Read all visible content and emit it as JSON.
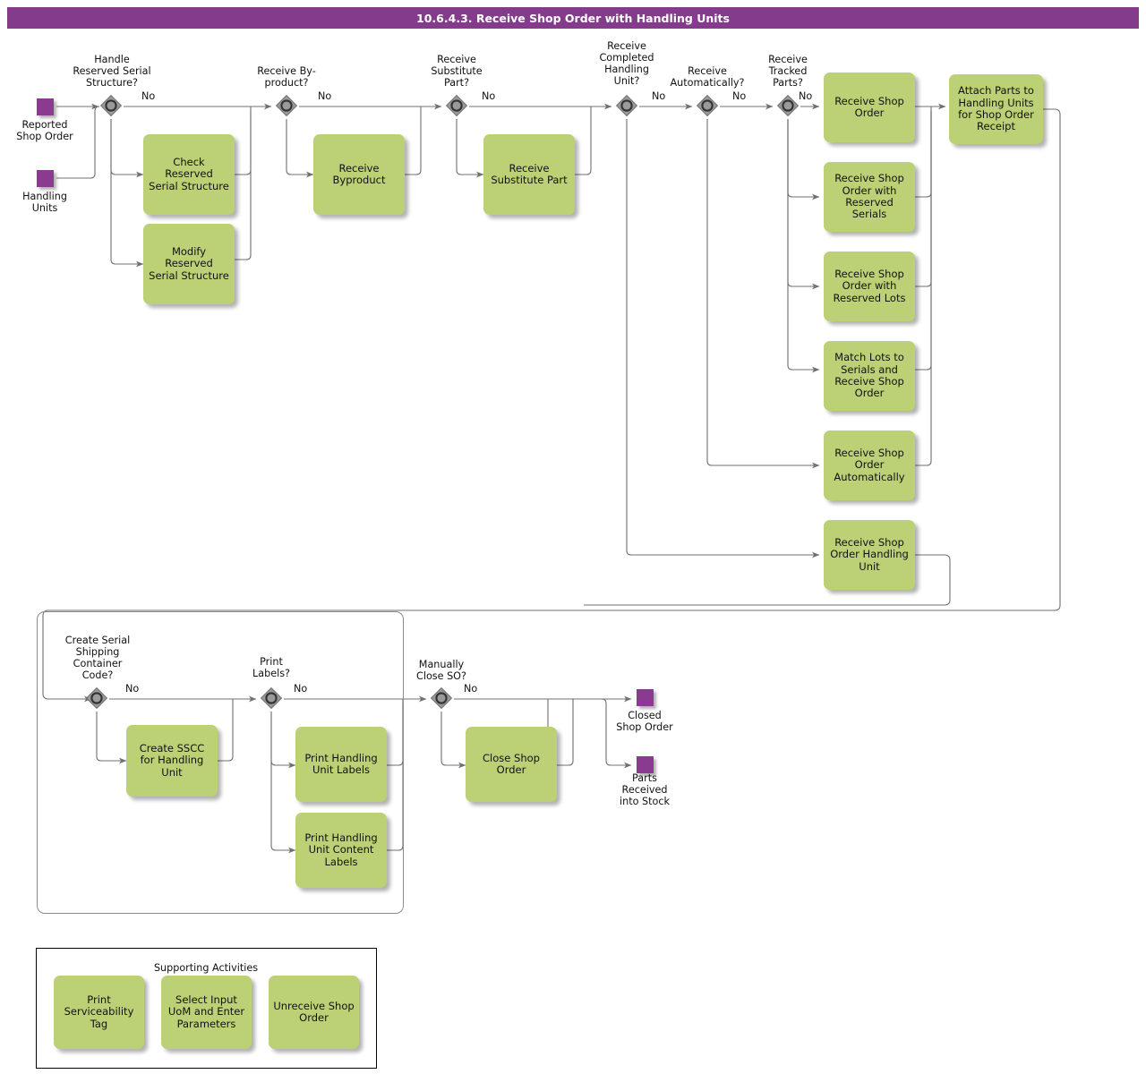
{
  "header": {
    "title": "10.6.4.3. Receive Shop Order with Handling Units"
  },
  "colors": {
    "header_bar": "#843b8c",
    "task_fill": "#bcd176",
    "event_fill": "#8b3a92",
    "gateway_fill": "#9a9a9a",
    "connector": "#707070"
  },
  "start_events": [
    {
      "id": "reported-shop-order",
      "label": "Reported\nShop Order"
    },
    {
      "id": "handling-units",
      "label": "Handling\nUnits"
    }
  ],
  "end_events": [
    {
      "id": "closed-shop-order",
      "label": "Closed\nShop Order"
    },
    {
      "id": "parts-received-into-stock",
      "label": "Parts\nReceived\ninto Stock"
    }
  ],
  "gateways": [
    {
      "id": "handle-reserved-serial-structure",
      "label": "Handle\nReserved Serial\nStructure?",
      "branch": "No"
    },
    {
      "id": "receive-byproduct",
      "label": "Receive By-\nproduct?",
      "branch": "No"
    },
    {
      "id": "receive-substitute-part",
      "label": "Receive\nSubstitute\nPart?",
      "branch": "No"
    },
    {
      "id": "receive-completed-handling-unit",
      "label": "Receive\nCompleted\nHandling\nUnit?",
      "branch": "No"
    },
    {
      "id": "receive-automatically",
      "label": "Receive\nAutomatically?",
      "branch": "No"
    },
    {
      "id": "receive-tracked-parts",
      "label": "Receive\nTracked\nParts?",
      "branch": "No"
    },
    {
      "id": "create-sscc",
      "label": "Create Serial\nShipping\nContainer\nCode?",
      "branch": "No"
    },
    {
      "id": "print-labels",
      "label": "Print\nLabels?",
      "branch": "No"
    },
    {
      "id": "manually-close-so",
      "label": "Manually\nClose SO?",
      "branch": "No"
    }
  ],
  "tasks": [
    {
      "id": "check-reserved-serial-structure",
      "label": "Check Reserved\nSerial Structure"
    },
    {
      "id": "modify-reserved-serial-structure",
      "label": "Modify Reserved\nSerial Structure"
    },
    {
      "id": "receive-byproduct-task",
      "label": "Receive\nByproduct"
    },
    {
      "id": "receive-substitute-part-task",
      "label": "Receive\nSubstitute Part"
    },
    {
      "id": "receive-shop-order",
      "label": "Receive Shop\nOrder"
    },
    {
      "id": "receive-shop-order-reserved-serials",
      "label": "Receive Shop\nOrder with\nReserved Serials"
    },
    {
      "id": "receive-shop-order-reserved-lots",
      "label": "Receive Shop\nOrder with\nReserved Lots"
    },
    {
      "id": "match-lots-to-serials",
      "label": "Match Lots to\nSerials and\nReceive Shop\nOrder"
    },
    {
      "id": "receive-shop-order-automatically",
      "label": "Receive Shop\nOrder\nAutomatically"
    },
    {
      "id": "receive-shop-order-handling-unit",
      "label": "Receive Shop\nOrder Handling\nUnit"
    },
    {
      "id": "attach-parts-to-handling-units",
      "label": "Attach Parts to\nHandling Units\nfor Shop Order\nReceipt"
    },
    {
      "id": "create-sscc-for-handling-unit",
      "label": "Create SSCC\nfor Handling Unit"
    },
    {
      "id": "print-handling-unit-labels",
      "label": "Print Handling\nUnit Labels"
    },
    {
      "id": "print-handling-unit-content-labels",
      "label": "Print Handling\nUnit Content\nLabels"
    },
    {
      "id": "close-shop-order",
      "label": "Close Shop\nOrder"
    }
  ],
  "supporting": {
    "title": "Supporting Activities",
    "tasks": [
      {
        "id": "print-serviceability-tag",
        "label": "Print\nServiceability\nTag"
      },
      {
        "id": "select-input-uom",
        "label": "Select Input\nUoM and Enter\nParameters"
      },
      {
        "id": "unreceive-shop-order",
        "label": "Unreceive Shop\nOrder"
      }
    ]
  }
}
